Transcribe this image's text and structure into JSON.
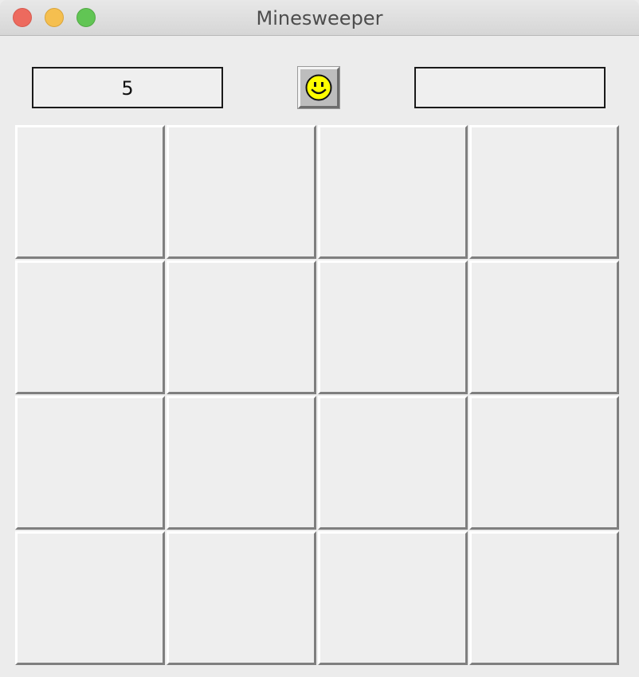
{
  "window": {
    "title": "Minesweeper"
  },
  "header": {
    "mine_counter": "5",
    "timer": "",
    "reset_face": "smiley-face-icon"
  },
  "board": {
    "rows": 4,
    "cols": 4,
    "cells": [
      [
        "hidden",
        "hidden",
        "hidden",
        "hidden"
      ],
      [
        "hidden",
        "hidden",
        "hidden",
        "hidden"
      ],
      [
        "hidden",
        "hidden",
        "hidden",
        "hidden"
      ],
      [
        "hidden",
        "hidden",
        "hidden",
        "hidden"
      ]
    ]
  },
  "colors": {
    "close": "#ed6a5e",
    "minimize": "#f5bf4f",
    "zoom": "#61c554",
    "smiley": "#ffff00"
  }
}
